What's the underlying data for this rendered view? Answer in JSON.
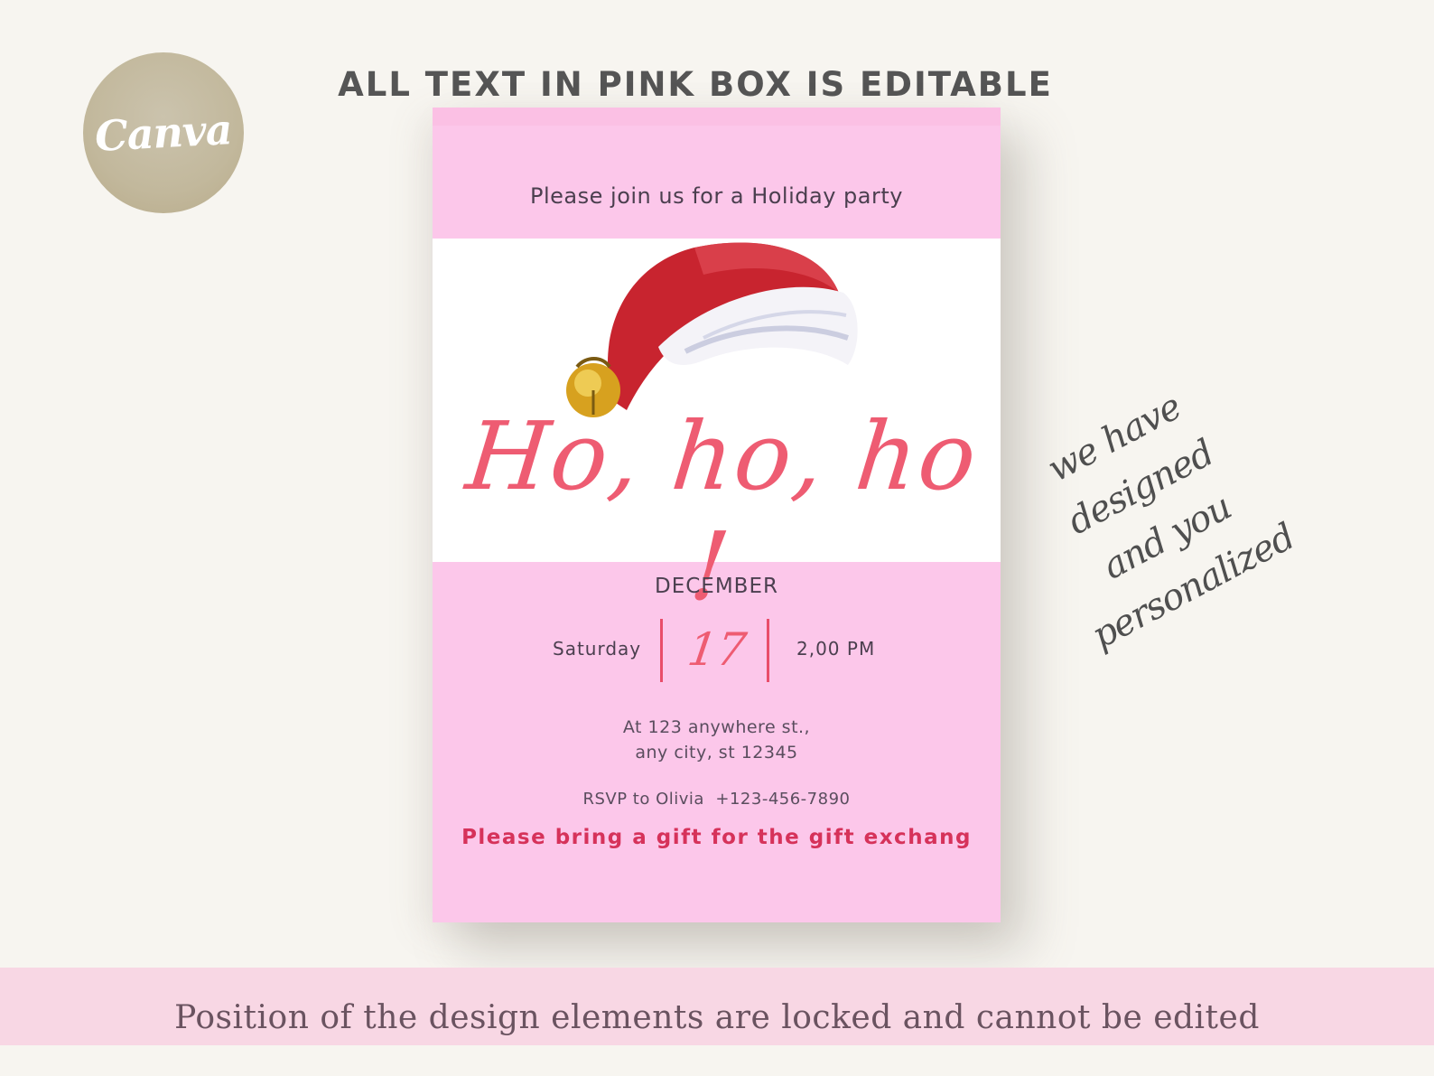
{
  "logo": {
    "text": "Canva"
  },
  "header": {
    "title": "ALL TEXT IN PINK BOX IS EDITABLE"
  },
  "invitation": {
    "intro": "Please join us for a Holiday party",
    "headline": "Ho, ho, ho !",
    "month": "DECEMBER",
    "weekday": "Saturday",
    "day": "17",
    "time": "2,00 PM",
    "address_line1": "At 123 anywhere st.,",
    "address_line2": "any city, st 12345",
    "rsvp": "RSVP to Olivia  +123-456-7890",
    "note": "Please bring a gift for the gift exchang"
  },
  "side_note": {
    "line1": "we have designed",
    "line2": "and you",
    "line3": "personalized"
  },
  "footer": {
    "text": "Position of the design elements are locked and cannot be edited"
  },
  "colors": {
    "background": "#f7f5f0",
    "card_pink": "#fcc7ea",
    "accent_red": "#ee5c72",
    "gift_text": "#d6325a",
    "banner_pink": "#f8d7e4",
    "logo_gold": "#c2b89c"
  },
  "icons": {
    "hat": "santa-hat-illustration"
  }
}
